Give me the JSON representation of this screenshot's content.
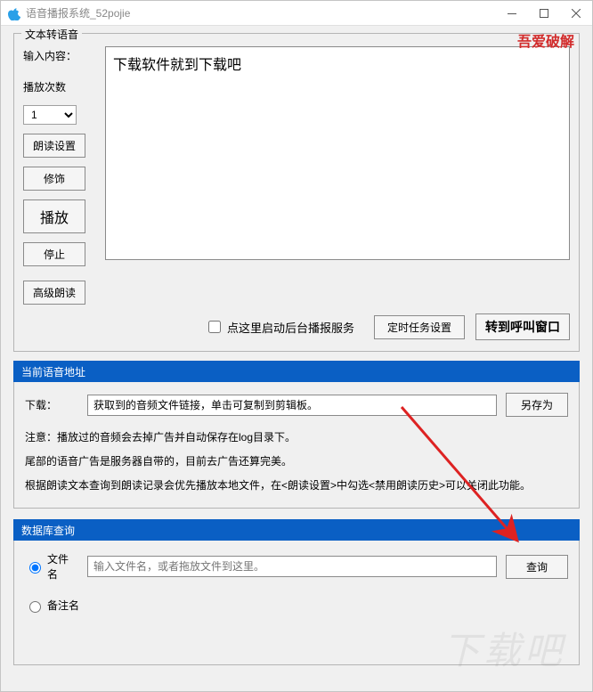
{
  "title": "语音播报系统_52pojie",
  "watermark_topright": "吾爱破解",
  "watermark_bg": "下载吧",
  "tts_group": {
    "legend": "文本转语音",
    "input_label": "输入内容：",
    "textarea_value": "下载软件就到下载吧",
    "playcount_label": "播放次数",
    "playcount_value": "1",
    "btn_read_setting": "朗读设置",
    "btn_decorate": "修饰",
    "btn_play": "播放",
    "btn_stop": "停止",
    "btn_advanced": "高级朗读",
    "chk_bgservice": "点这里启动后台播报服务",
    "btn_timer": "定时任务设置",
    "btn_gotocall": "转到呼叫窗口"
  },
  "addr_section": {
    "header": "当前语音地址",
    "download_label": "下载：",
    "download_value": "获取到的音频文件链接，单击可复制到剪辑板。",
    "btn_saveas": "另存为",
    "note1": "注意：播放过的音频会去掉广告并自动保存在log目录下。",
    "note2": "尾部的语音广告是服务器自带的，目前去广告还算完美。",
    "note3": "根据朗读文本查询到朗读记录会优先播放本地文件，在<朗读设置>中勾选<禁用朗读历史>可以关闭此功能。"
  },
  "db_section": {
    "header": "数据库查询",
    "radio_filename": "文件名",
    "radio_remark": "备注名",
    "input_placeholder": "输入文件名，或者拖放文件到这里。",
    "btn_query": "查询"
  }
}
